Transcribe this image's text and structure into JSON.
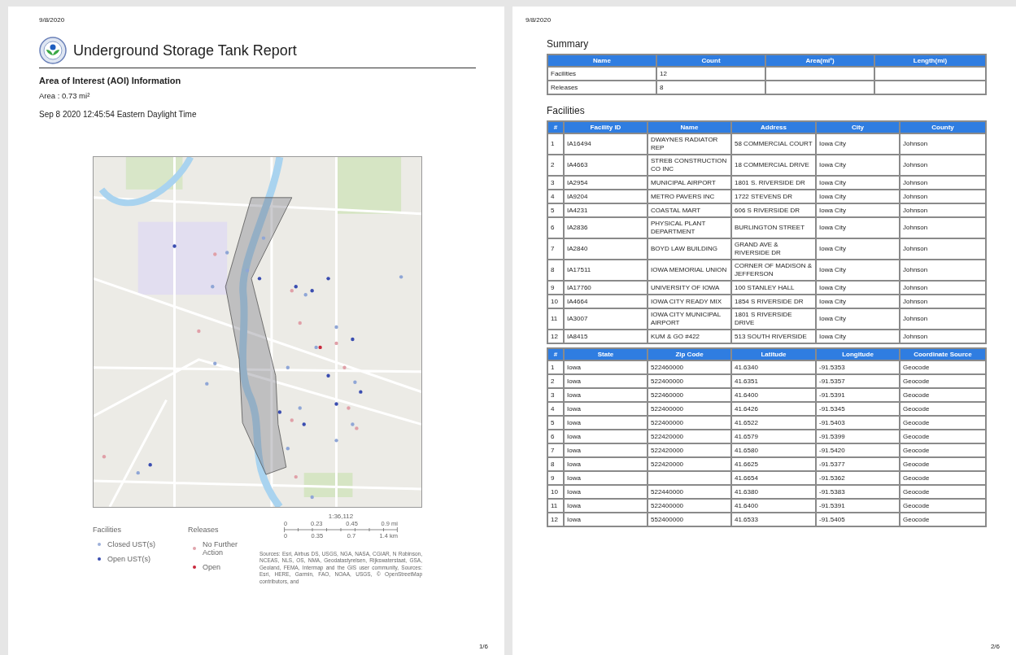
{
  "page_1": {
    "header_date": "9/8/2020",
    "title": "Underground Storage Tank Report",
    "aoi_heading": "Area of Interest (AOI) Information",
    "area": "Area : 0.73 mi²",
    "timestamp": "Sep 8 2020 12:45:54 Eastern Daylight Time",
    "legend": {
      "facilities_heading": "Facilities",
      "releases_heading": "Releases",
      "facilities": [
        {
          "label": "Closed UST(s)",
          "color": "#9db0da"
        },
        {
          "label": "Open UST(s)",
          "color": "#3a4db0"
        }
      ],
      "releases": [
        {
          "label": "No Further Action",
          "color": "#e0a4ac"
        },
        {
          "label": "Open",
          "color": "#c8283c"
        }
      ]
    },
    "scale": {
      "ratio": "1:36,112",
      "mi_ticks": [
        "0",
        "0.23",
        "0.45",
        "0.9 mi"
      ],
      "km_ticks": [
        "0",
        "0.35",
        "0.7",
        "1.4 km"
      ]
    },
    "attribution": "Sources: Esri, Airbus DS, USGS, NGA, NASA, CGIAR, N Robinson, NCEAS, NLS, OS, NMA, Geodatastyrelsen, Rijkswaterstaat, GSA, Geoland, FEMA, Intermap and the GIS user community, Sources: Esri, HERE, Garmin, FAO, NOAA, USGS, © OpenStreetMap contributors, and",
    "page_number": "1/6"
  },
  "page_2": {
    "header_date": "9/8/2020",
    "summary": {
      "heading": "Summary",
      "columns": [
        "Name",
        "Count",
        "Area(mi²)",
        "Length(mi)"
      ],
      "rows": [
        [
          "Facilities",
          "12",
          null,
          null
        ],
        [
          "Releases",
          "8",
          null,
          null
        ]
      ]
    },
    "facilities": {
      "heading": "Facilities",
      "columns": [
        "#",
        "Facility ID",
        "Name",
        "Address",
        "City",
        "County"
      ],
      "rows": [
        [
          "1",
          "IA16494",
          "DWAYNES RADIATOR REP",
          "58 COMMERCIAL COURT",
          "Iowa City",
          "Johnson"
        ],
        [
          "2",
          "IA4663",
          "STREB CONSTRUCTION CO INC",
          "18 COMMERCIAL DRIVE",
          "Iowa City",
          "Johnson"
        ],
        [
          "3",
          "IA2954",
          "MUNICIPAL AIRPORT",
          "1801 S. RIVERSIDE DR",
          "Iowa City",
          "Johnson"
        ],
        [
          "4",
          "IA9204",
          "METRO PAVERS INC",
          "1722 STEVENS DR",
          "Iowa City",
          "Johnson"
        ],
        [
          "5",
          "IA4231",
          "COASTAL MART",
          "606 S RIVERSIDE DR",
          "Iowa City",
          "Johnson"
        ],
        [
          "6",
          "IA2836",
          "PHYSICAL PLANT DEPARTMENT",
          "BURLINGTON STREET",
          "Iowa City",
          "Johnson"
        ],
        [
          "7",
          "IA2840",
          "BOYD LAW BUILDING",
          "GRAND AVE & RIVERSIDE DR",
          "Iowa City",
          "Johnson"
        ],
        [
          "8",
          "IA17511",
          "IOWA MEMORIAL UNION",
          "CORNER OF MADISON & JEFFERSON",
          "Iowa City",
          "Johnson"
        ],
        [
          "9",
          "IA17760",
          "UNIVERSITY OF IOWA",
          "100 STANLEY HALL",
          "Iowa City",
          "Johnson"
        ],
        [
          "10",
          "IA4664",
          "IOWA CITY READY MIX",
          "1854 S RIVERSIDE DR",
          "Iowa City",
          "Johnson"
        ],
        [
          "11",
          "IA3007",
          "IOWA CITY MUNICIPAL AIRPORT",
          "1801 S RIVERSIDE DRIVE",
          "Iowa City",
          "Johnson"
        ],
        [
          "12",
          "IA8415",
          "KUM & GO #422",
          "513 SOUTH RIVERSIDE",
          "Iowa City",
          "Johnson"
        ]
      ]
    },
    "locations": {
      "columns": [
        "#",
        "State",
        "Zip Code",
        "Latitude",
        "Longitude",
        "Coordinate Source"
      ],
      "rows": [
        [
          "1",
          "Iowa",
          "522460000",
          "41.6340",
          "-91.5353",
          "Geocode"
        ],
        [
          "2",
          "Iowa",
          "522400000",
          "41.6351",
          "-91.5357",
          "Geocode"
        ],
        [
          "3",
          "Iowa",
          "522460000",
          "41.6400",
          "-91.5391",
          "Geocode"
        ],
        [
          "4",
          "Iowa",
          "522400000",
          "41.6426",
          "-91.5345",
          "Geocode"
        ],
        [
          "5",
          "Iowa",
          "522400000",
          "41.6522",
          "-91.5403",
          "Geocode"
        ],
        [
          "6",
          "Iowa",
          "522420000",
          "41.6579",
          "-91.5399",
          "Geocode"
        ],
        [
          "7",
          "Iowa",
          "522420000",
          "41.6580",
          "-91.5420",
          "Geocode"
        ],
        [
          "8",
          "Iowa",
          "522420000",
          "41.6625",
          "-91.5377",
          "Geocode"
        ],
        [
          "9",
          "Iowa",
          null,
          "41.6654",
          "-91.5362",
          "Geocode"
        ],
        [
          "10",
          "Iowa",
          "522440000",
          "41.6380",
          "-91.5383",
          "Geocode"
        ],
        [
          "11",
          "Iowa",
          "522400000",
          "41.6400",
          "-91.5391",
          "Geocode"
        ],
        [
          "12",
          "Iowa",
          "552400000",
          "41.6533",
          "-91.5405",
          "Geocode"
        ]
      ]
    },
    "page_number": "2/6"
  }
}
